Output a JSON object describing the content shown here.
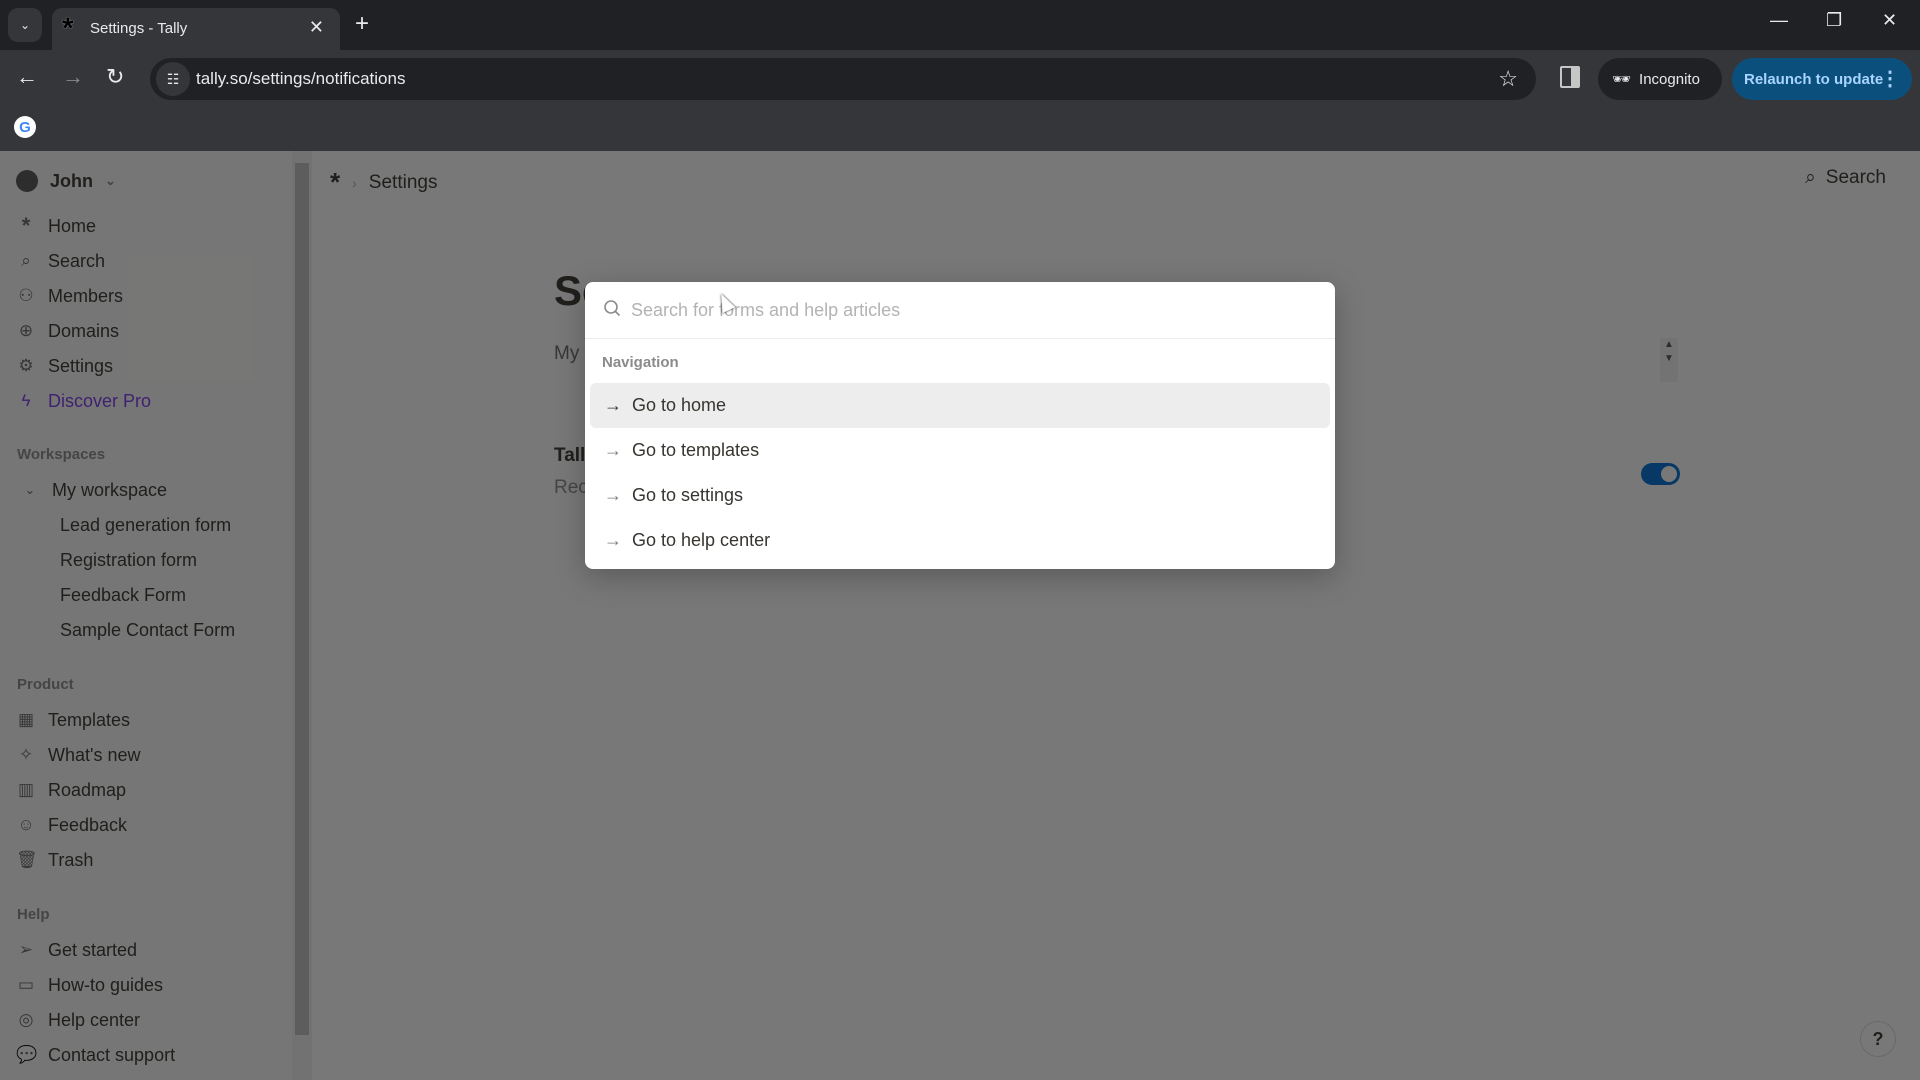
{
  "browser": {
    "tab_title": "Settings - Tally",
    "url": "tally.so/settings/notifications",
    "incognito_label": "Incognito",
    "relaunch_label": "Relaunch to update",
    "colors": {
      "relaunch_bg": "#0b4f7c",
      "relaunch_text": "#a8d4ff"
    }
  },
  "sidebar": {
    "user": "John",
    "main_items": [
      {
        "label": "Home",
        "icon": "tally-asterisk-icon"
      },
      {
        "label": "Search",
        "icon": "search-icon"
      },
      {
        "label": "Members",
        "icon": "members-icon"
      },
      {
        "label": "Domains",
        "icon": "globe-icon"
      },
      {
        "label": "Settings",
        "icon": "gear-icon"
      },
      {
        "label": "Discover Pro",
        "icon": "lightning-icon"
      }
    ],
    "workspaces_heading": "Workspaces",
    "workspace_name": "My workspace",
    "forms": [
      "Lead generation form",
      "Registration form",
      "Feedback Form",
      "Sample Contact Form"
    ],
    "product_heading": "Product",
    "product_items": [
      {
        "label": "Templates",
        "icon": "templates-icon"
      },
      {
        "label": "What's new",
        "icon": "sparkle-icon"
      },
      {
        "label": "Roadmap",
        "icon": "map-icon"
      },
      {
        "label": "Feedback",
        "icon": "smiley-icon"
      },
      {
        "label": "Trash",
        "icon": "trash-icon"
      }
    ],
    "help_heading": "Help",
    "help_items": [
      {
        "label": "Get started",
        "icon": "send-icon"
      },
      {
        "label": "How-to guides",
        "icon": "book-icon"
      },
      {
        "label": "Help center",
        "icon": "lifebuoy-icon"
      },
      {
        "label": "Contact support",
        "icon": "chat-bubble-icon"
      }
    ],
    "accent_color": "#7c3aed"
  },
  "main": {
    "breadcrumb": "Settings",
    "search_label": "Search",
    "title_partial": "Se",
    "tab_partial": "My",
    "row_title_partial": "Tall",
    "row_desc_partial": "Rec",
    "toggle_on": true,
    "help_label": "?"
  },
  "modal": {
    "search_placeholder": "Search for forms and help articles",
    "search_value": "",
    "section_label": "Navigation",
    "items": [
      "Go to home",
      "Go to templates",
      "Go to settings",
      "Go to help center"
    ],
    "active_index": 0
  }
}
